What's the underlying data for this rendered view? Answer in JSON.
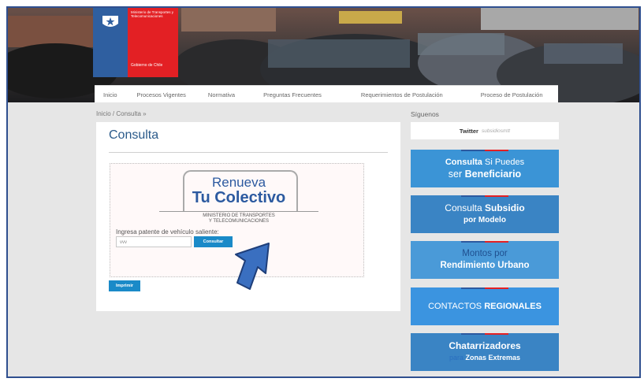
{
  "header": {
    "ministry": "Ministerio de Transportes y Telecomunicaciones",
    "government": "Gobierno de Chile"
  },
  "nav": {
    "items": [
      {
        "label": "Inicio"
      },
      {
        "label": "Procesos Vigentes"
      },
      {
        "label": "Normativa"
      },
      {
        "label": "Preguntas Frecuentes"
      },
      {
        "label": "Requerimientos de Postulación"
      },
      {
        "label": "Proceso de Postulación"
      }
    ]
  },
  "breadcrumb": "Inicio / Consulta »",
  "main": {
    "title": "Consulta",
    "logo_line1": "Renueva",
    "logo_line2": "Tu Colectivo",
    "ministry_line1": "MINISTERIO DE TRANSPORTES",
    "ministry_line2": "Y TELECOMUNICACIONES",
    "plate_label": "Ingresa patente de vehículo saliente:",
    "plate_value": "vvv",
    "consult_button": "Consultar",
    "print_button": "Imprimir"
  },
  "sidebar": {
    "follow_label": "Síguenos",
    "twitter_label": "Twitter",
    "twitter_handle": "subsidiosmtt",
    "banners": [
      {
        "line1_normal": "Consulta",
        "line1_bold": "Si Puedes",
        "line2_normal": "ser",
        "line2_bold": "Beneficiario"
      },
      {
        "line1_normal": "Consulta",
        "line1_bold": "Subsidio",
        "line2_bold": "por Modelo"
      },
      {
        "line1_normal": "Montos por",
        "line2_bold": "Rendimiento Urbano"
      },
      {
        "line1_normal": "CONTACTOS",
        "line1_bold": "REGIONALES"
      },
      {
        "line1_bold": "Chatarrizadores",
        "line2_normal": "para",
        "line2_bold": "Zonas Extremas"
      }
    ]
  },
  "colors": {
    "accent_blue": "#1a8ac8",
    "banner_blue": "#3b94d6",
    "banner_dark": "#3a84c4",
    "brand_red": "#e32024",
    "brand_blue": "#2f5fa0"
  },
  "icons": [
    "chile-crest-icon",
    "pointer-arrow-icon"
  ]
}
